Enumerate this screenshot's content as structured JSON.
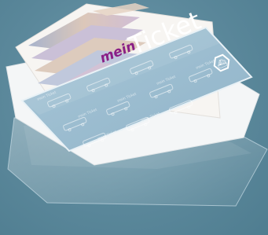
{
  "ticket": {
    "prefix": "mein",
    "brand": "Ticket",
    "watermark_text": "mein Ticket",
    "logo_glyph": "⛴"
  },
  "colors": {
    "background": "#5e8a9d",
    "ticket_blue": "#9fc0d3",
    "prefix_purple": "#8a1f86",
    "brand_white": "#ffffff"
  }
}
